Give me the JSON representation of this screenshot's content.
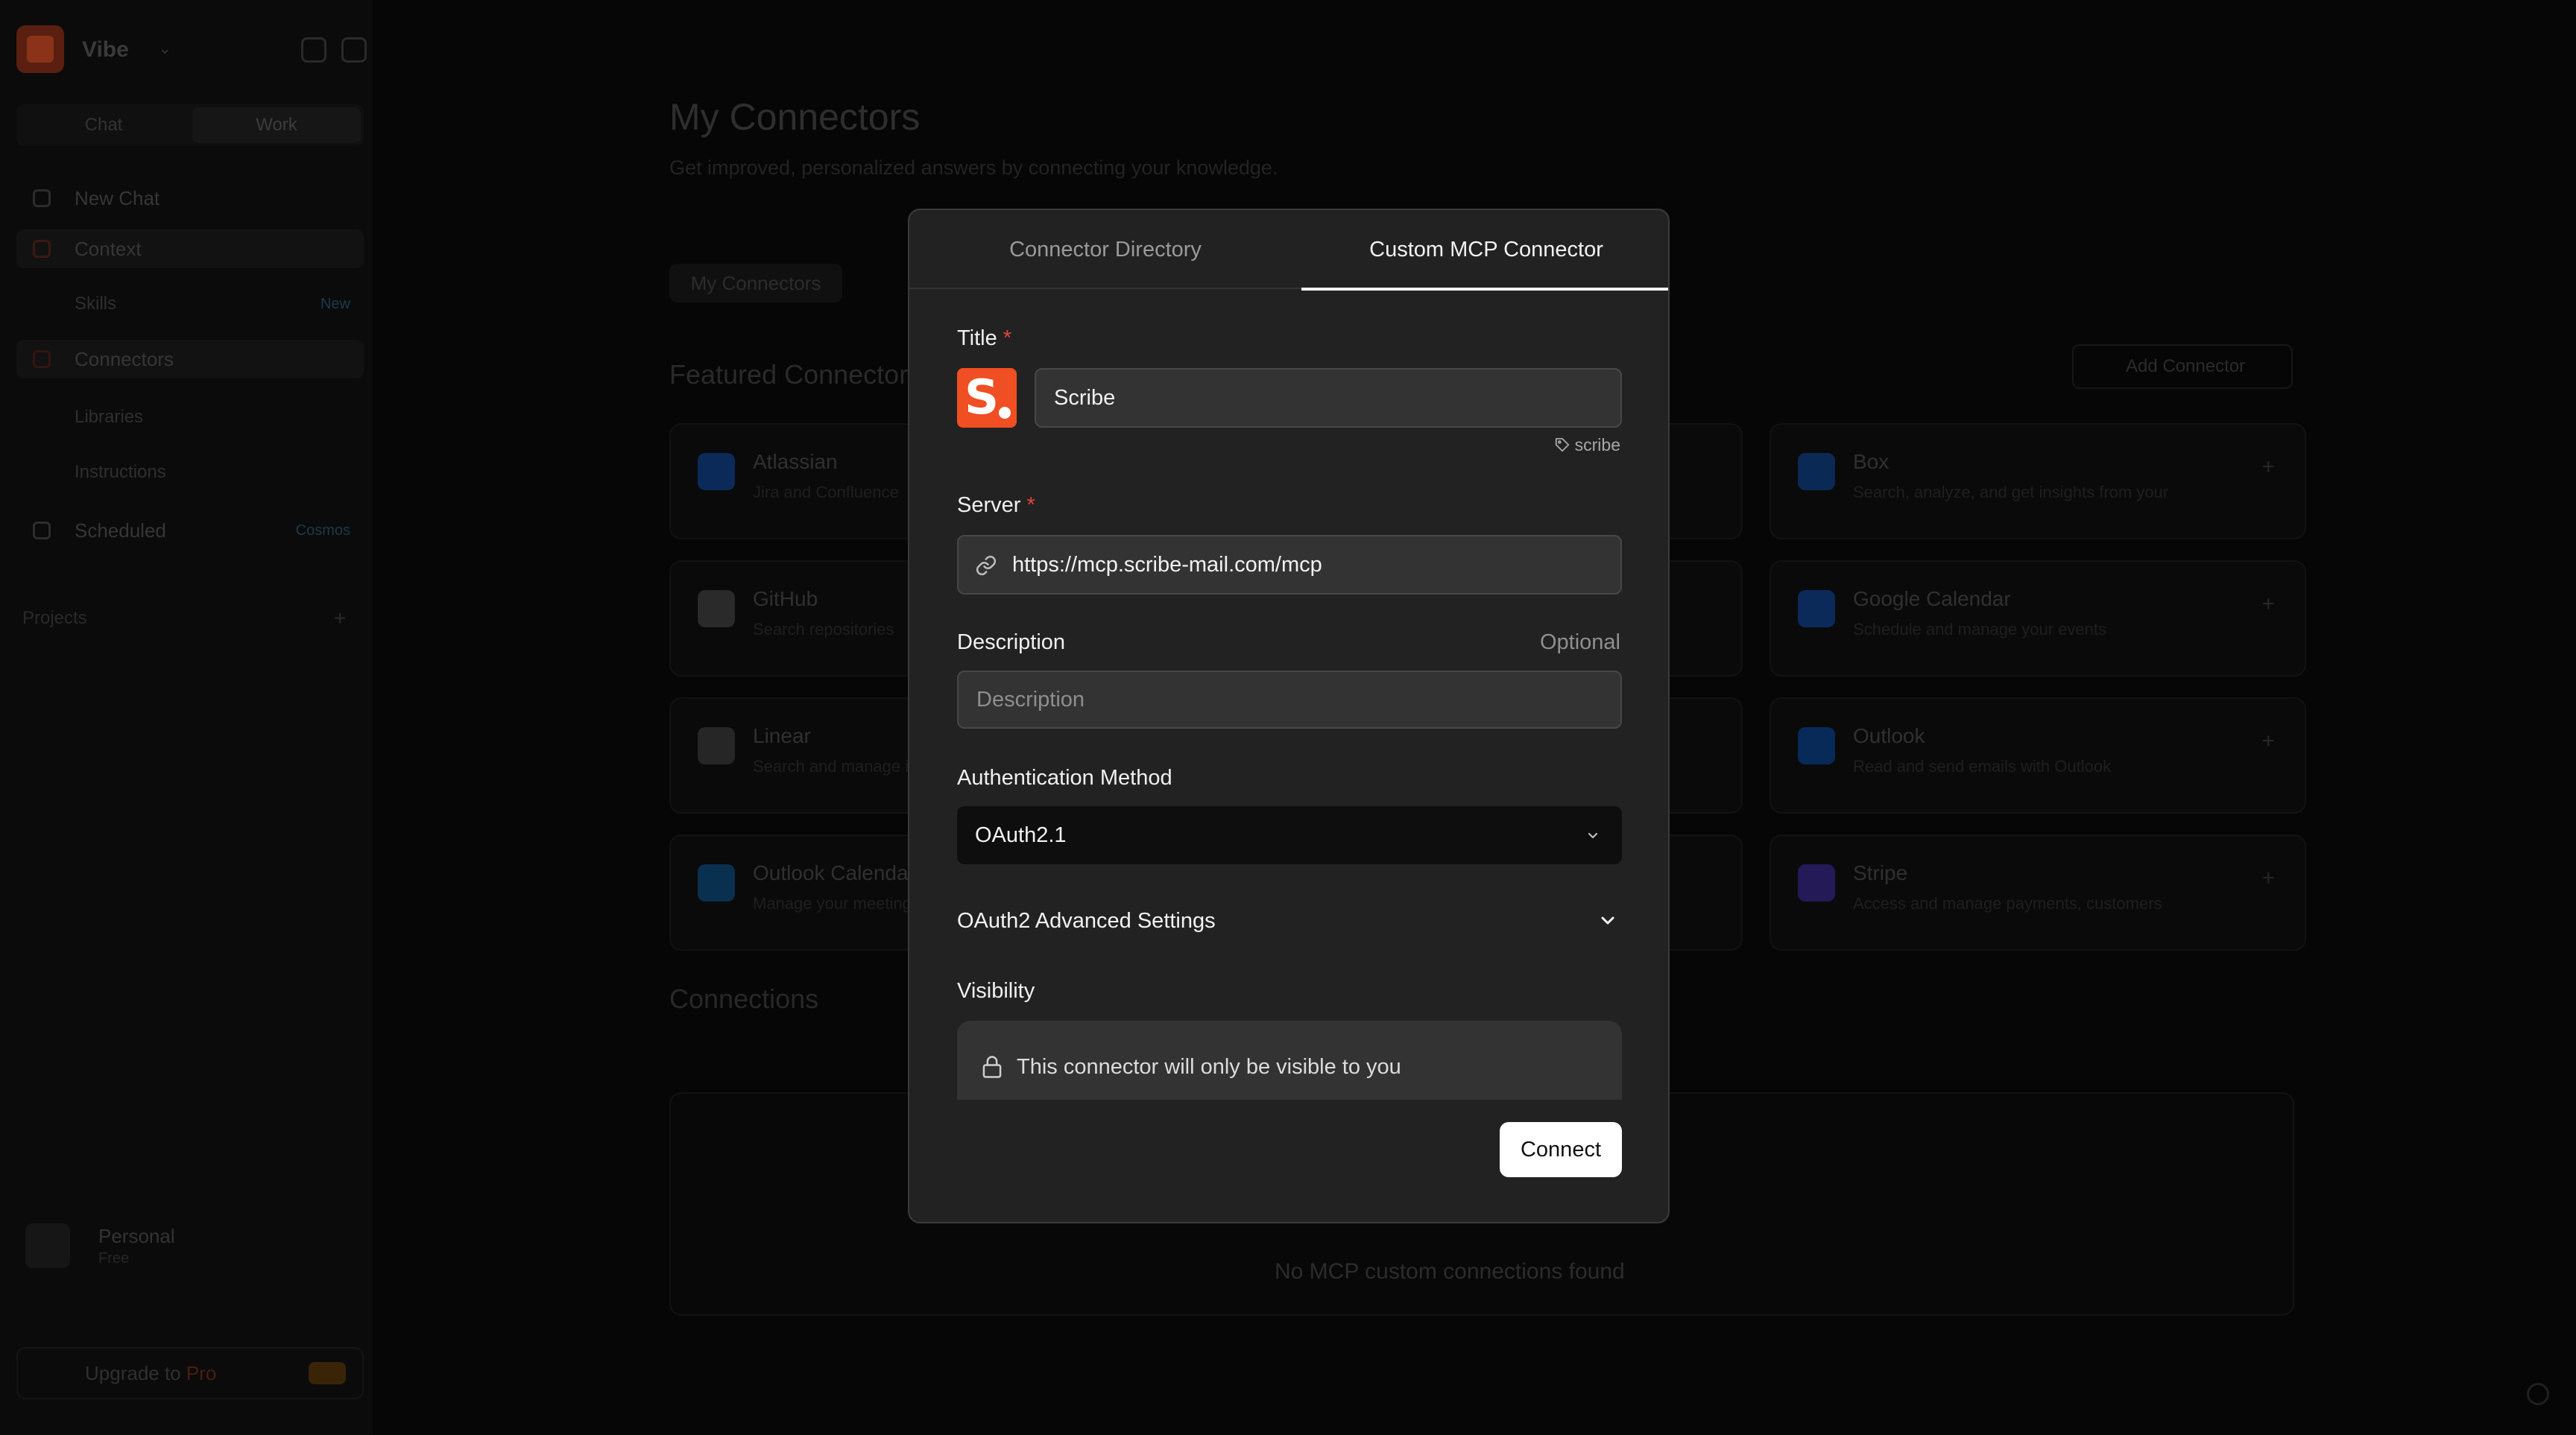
{
  "background": {
    "workspace": {
      "name": "Vibe"
    },
    "sidebar": {
      "toggle": [
        "Chat",
        "Work"
      ],
      "items": [
        {
          "label": "New Chat"
        },
        {
          "label": "Context"
        },
        {
          "label": "Skills",
          "badge": "New"
        },
        {
          "label": "Connectors"
        },
        {
          "label": "Libraries"
        },
        {
          "label": "Instructions"
        },
        {
          "label": "Scheduled",
          "badge": "Cosmos"
        }
      ],
      "section_label": "Projects",
      "user": {
        "name": "Personal",
        "plan": "Free"
      },
      "upgrade": {
        "label": "Upgrade to",
        "plan": "Pro"
      }
    },
    "main": {
      "title": "My Connectors",
      "subtitle": "Get improved, personalized answers by connecting your knowledge.",
      "tab": "My Connectors",
      "featured_title": "Featured Connectors",
      "add_button": "Add Connector",
      "cards": [
        {
          "title": "Atlassian",
          "desc": "Jira and Confluence",
          "color": "#0b2a5a"
        },
        {
          "title": "Box",
          "desc": "Search, analyze, and get insights from your",
          "color": "#0a2a55"
        },
        {
          "title": "GitHub",
          "desc": "Search repositories",
          "color": "#2a2a2a"
        },
        {
          "title": "Google Calendar",
          "desc": "Schedule and manage your events",
          "color": "#0b2a5a"
        },
        {
          "title": "Linear",
          "desc": "Search and manage issues",
          "color": "#262626"
        },
        {
          "title": "Outlook",
          "desc": "Read and send emails with Outlook",
          "color": "#082a58"
        },
        {
          "title": "Outlook Calendar",
          "desc": "Manage your meetings",
          "color": "#0a3050"
        },
        {
          "title": "Stripe",
          "desc": "Access and manage payments, customers",
          "color": "#241a58"
        }
      ],
      "connections_title": "Connections",
      "empty_text": "No MCP custom connections found"
    }
  },
  "modal": {
    "tabs": [
      {
        "label": "Connector Directory",
        "active": false
      },
      {
        "label": "Custom MCP Connector",
        "active": true
      }
    ],
    "title_label": "Title",
    "required_mark": "*",
    "title_value": "Scribe",
    "logo_letter": "S",
    "logo_color": "#f04e23",
    "slug": "scribe",
    "server_label": "Server",
    "server_value": "https://mcp.scribe-mail.com/mcp",
    "description_label": "Description",
    "optional_label": "Optional",
    "description_placeholder": "Description",
    "auth_label": "Authentication Method",
    "auth_value": "OAuth2.1",
    "advanced_label": "OAuth2 Advanced Settings",
    "visibility_label": "Visibility",
    "visibility_text": "This connector will only be visible to you",
    "connect_button": "Connect"
  },
  "icons": [
    "tag-icon",
    "link-icon",
    "chevron-down-icon",
    "lock-icon"
  ]
}
